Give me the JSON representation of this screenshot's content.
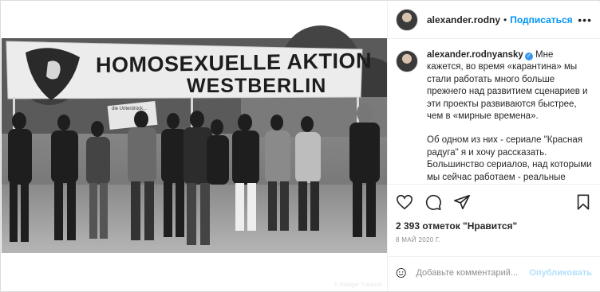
{
  "post": {
    "banner_line1": "HOMOSEXUELLE AKTION",
    "banner_line2": "WESTBERLIN",
    "sign_text": "die Unterdrück...",
    "photo_credit": "© Rüdiger Trautsch"
  },
  "header": {
    "username": "alexander.rodnyansky",
    "separator": "•",
    "follow_label": "Подписаться",
    "more_label": "•••"
  },
  "caption": {
    "username": "alexander.rodnyansky",
    "verified_mark": "✓",
    "paragraph1": "Мне кажется, во время «карантина» мы стали работать много больше прежнего над развитием сценариев и эти проекты развиваются быстрее, чем в «мирные времена».",
    "paragraph2": "Об одном из них - сериале \"Красная радуга\" я и хочу рассказать. Большинство сериалов, над которыми мы сейчас работаем - реальные"
  },
  "actions": {
    "like": "heart-icon",
    "comment": "comment-icon",
    "share": "share-icon",
    "save": "bookmark-icon"
  },
  "stats": {
    "likes_text": "2 393 отметок \"Нравится\"",
    "date_text": "8 МАЙ 2020 Г."
  },
  "comment_box": {
    "placeholder": "Добавьте комментарий...",
    "value": "",
    "publish_label": "Опубликовать"
  },
  "colors": {
    "accent": "#0095f6",
    "publish_disabled": "#b2dffc",
    "text": "#262626",
    "muted": "#8e8e8e",
    "border": "#dbdbdb"
  }
}
